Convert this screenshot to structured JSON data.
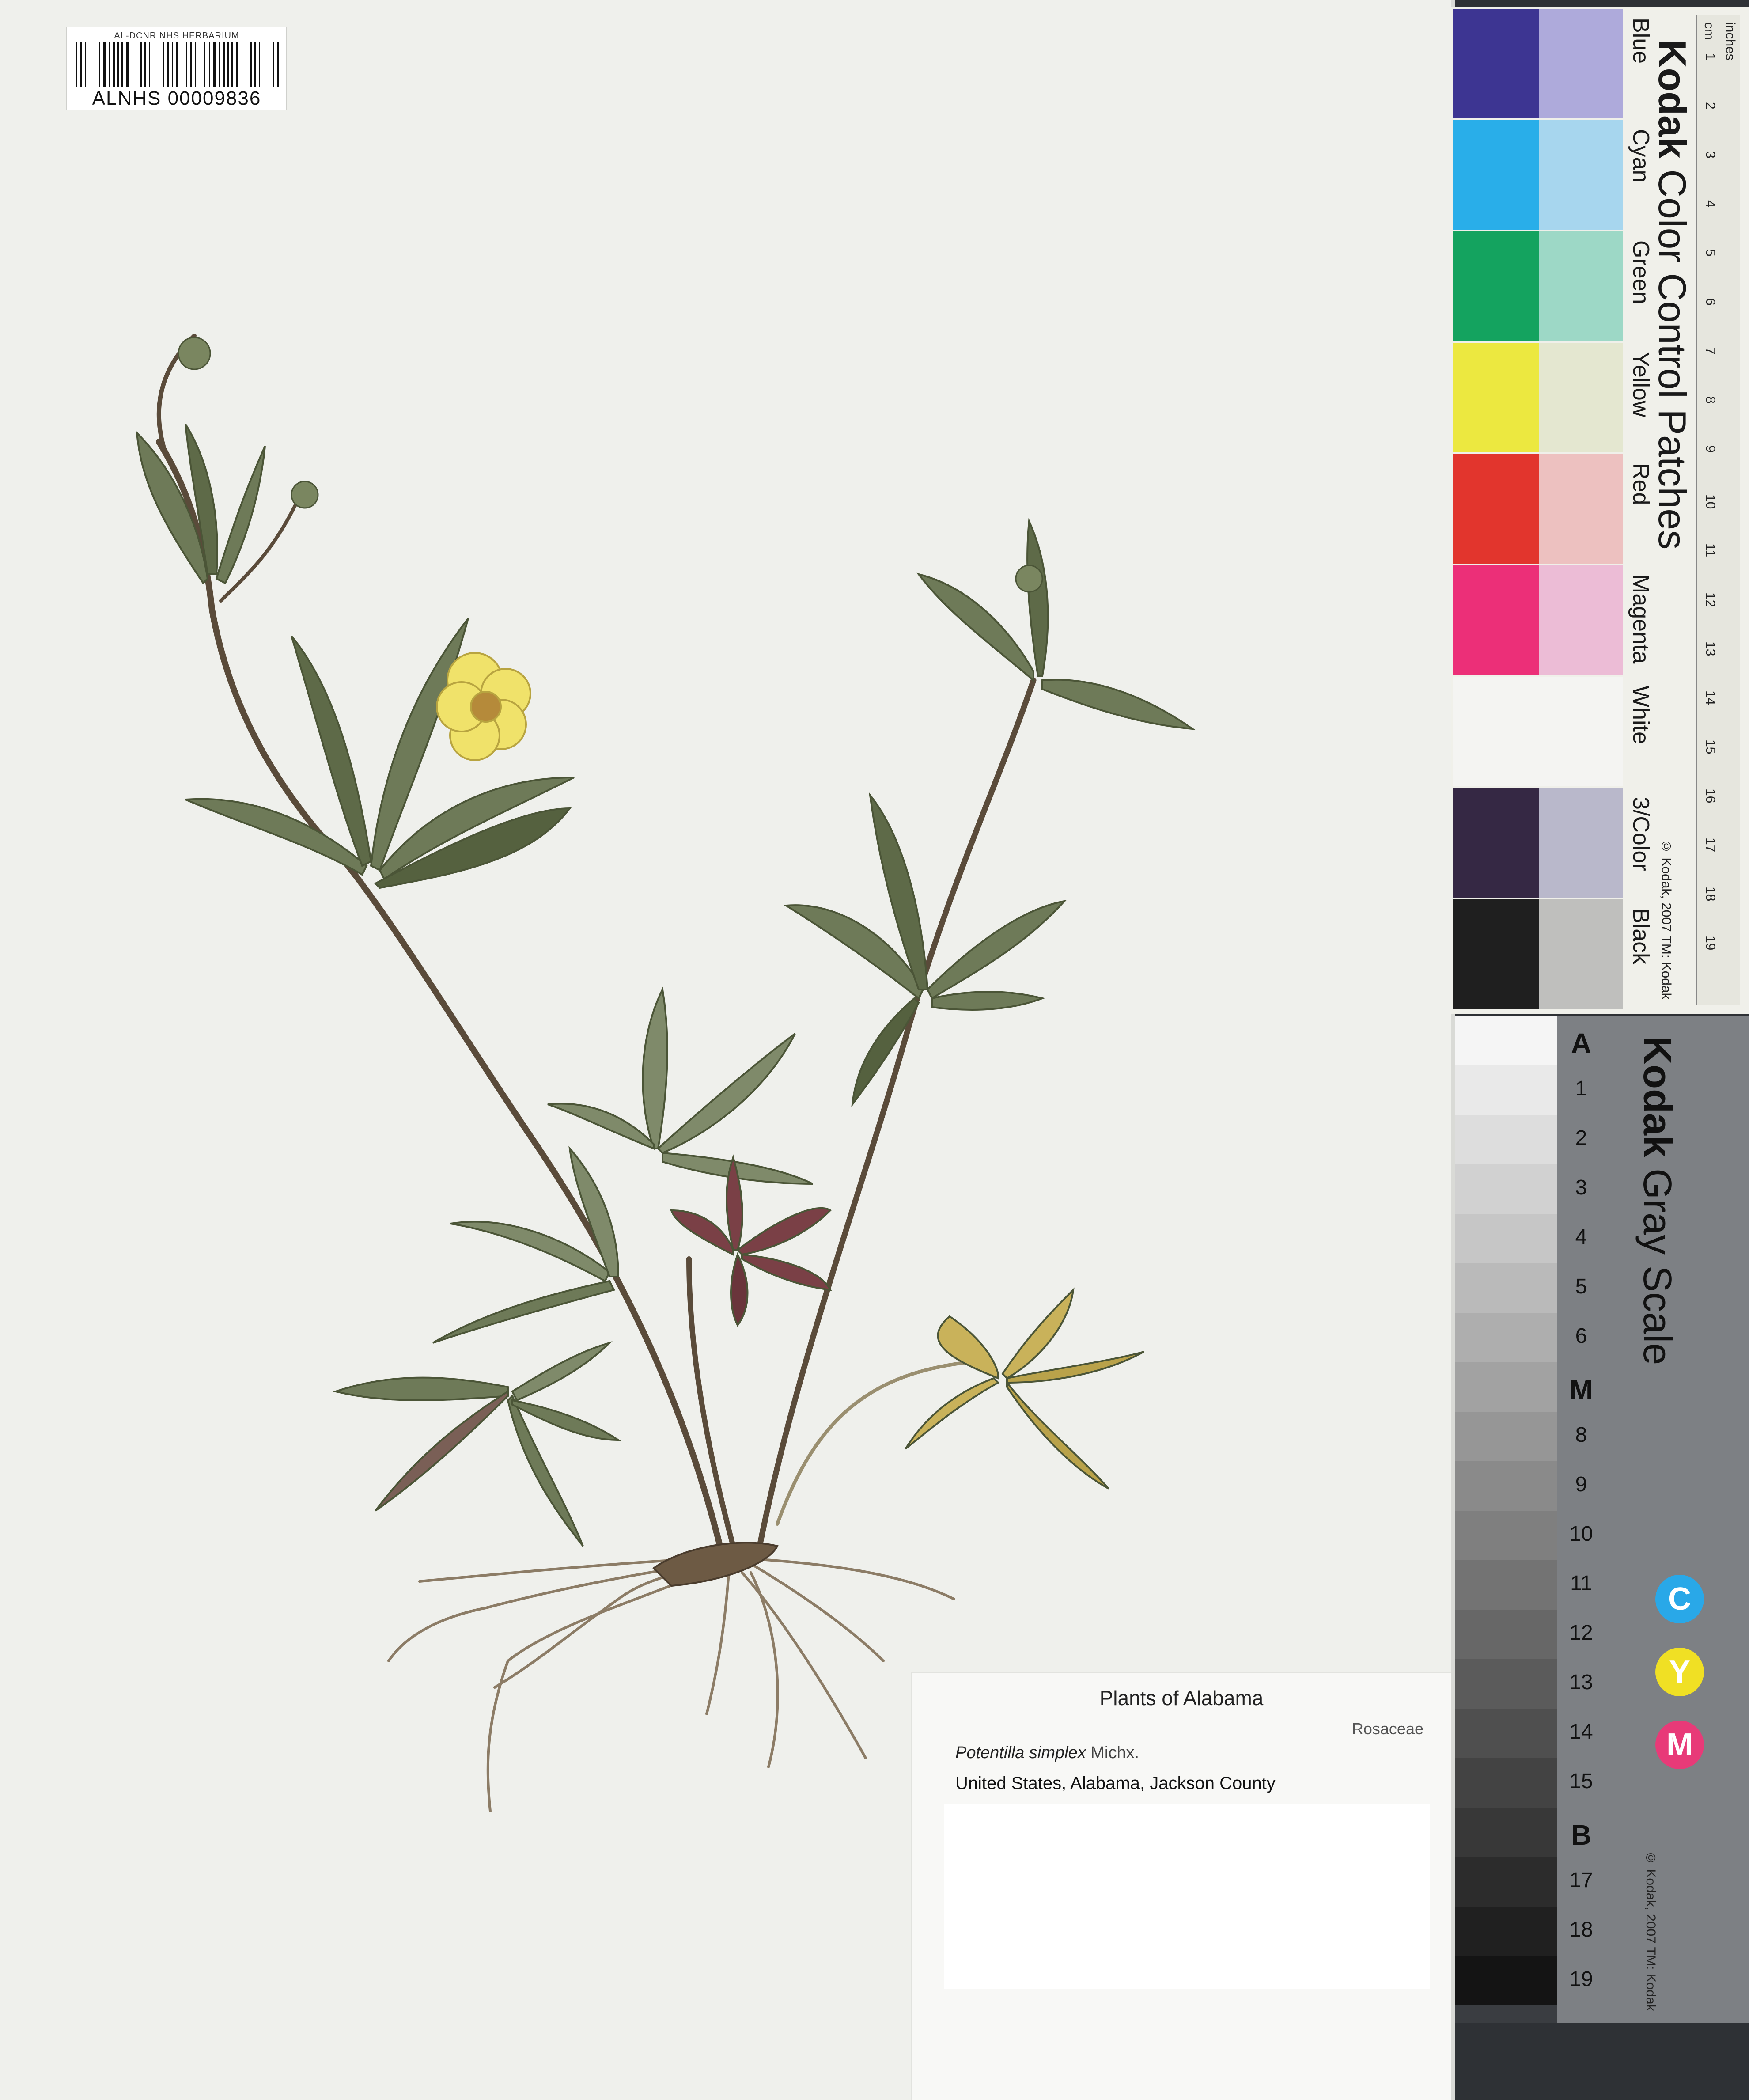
{
  "barcode": {
    "institution": "AL-DCNR NHS HERBARIUM",
    "id": "ALNHS 00009836"
  },
  "label": {
    "title": "Plants of Alabama",
    "family": "Rosaceae",
    "scientific_name": "Potentilla simplex",
    "author": "Michx.",
    "locality": "United States, Alabama, Jackson County"
  },
  "color_card": {
    "brand": "Kodak",
    "title": "Color Control Patches",
    "copyright": "© Kodak, 2007 TM: Kodak",
    "patches": [
      {
        "name": "Blue",
        "dark": "#3d3592",
        "light": "#aeaadb"
      },
      {
        "name": "Cyan",
        "dark": "#29aee9",
        "light": "#a7d6ee"
      },
      {
        "name": "Green",
        "dark": "#14a35f",
        "light": "#9dd8c6"
      },
      {
        "name": "Yellow",
        "dark": "#ece840",
        "light": "#e4e7d0"
      },
      {
        "name": "Red",
        "dark": "#e2352d",
        "light": "#edc1c0"
      },
      {
        "name": "Magenta",
        "dark": "#ec2f78",
        "light": "#ecbcd6"
      },
      {
        "name": "White",
        "dark": "#f4f4f2",
        "light": "#f4f4f2"
      },
      {
        "name": "3/Color",
        "dark": "#352844",
        "light": "#b9b8cb"
      },
      {
        "name": "Black",
        "dark": "#1f1f1f",
        "light": "#bfbfbd"
      }
    ],
    "ruler_cm": [
      "1",
      "2",
      "3",
      "4",
      "5",
      "6",
      "7",
      "8",
      "9",
      "10",
      "11",
      "12",
      "13",
      "14",
      "15",
      "16",
      "17",
      "18",
      "19"
    ],
    "ruler_unit_cm": "cm",
    "ruler_unit_in": "inches"
  },
  "gray_card": {
    "brand": "Kodak",
    "title": "Gray Scale",
    "copyright": "© Kodak, 2007 TM: Kodak",
    "steps": [
      "A",
      "1",
      "2",
      "3",
      "4",
      "5",
      "6",
      "M",
      "8",
      "9",
      "10",
      "11",
      "12",
      "13",
      "14",
      "15",
      "B",
      "17",
      "18",
      "19"
    ],
    "cym": [
      {
        "letter": "C",
        "color": "#29a8e8"
      },
      {
        "letter": "Y",
        "color": "#f0e024"
      },
      {
        "letter": "M",
        "color": "#e83a78"
      }
    ]
  },
  "colors": {
    "sheet": "#eff0ec",
    "stem": "#5a4b3a",
    "leaf": "#6e7a58",
    "leaf_dark": "#55613f",
    "leaf_purple": "#7a4046",
    "leaf_yellow": "#c9b25a",
    "flower": "#f0e26a"
  }
}
